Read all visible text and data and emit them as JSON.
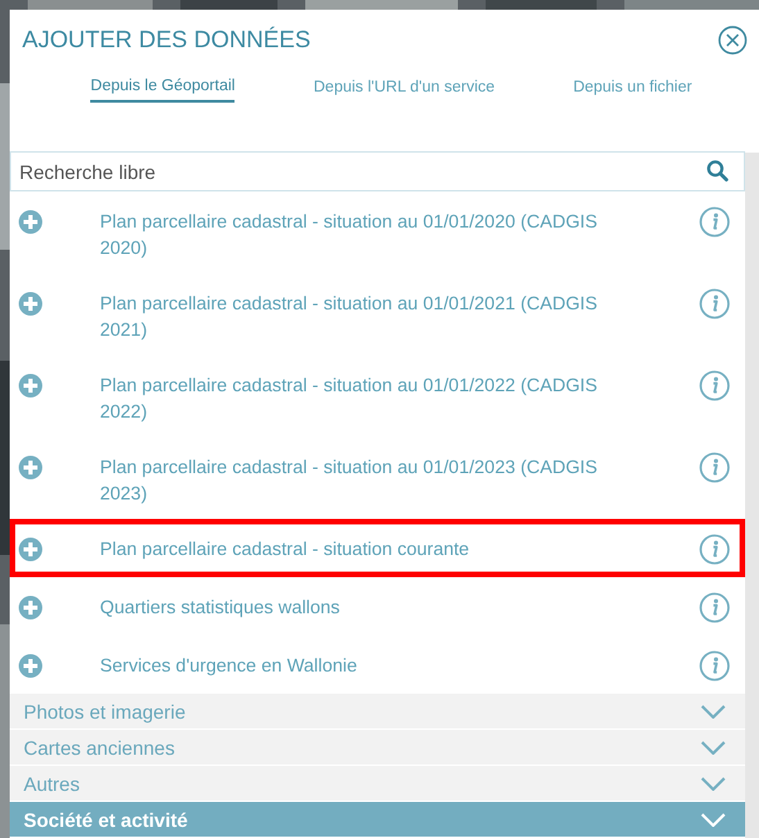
{
  "dialog": {
    "title": "AJOUTER DES DONNÉES"
  },
  "tabs": [
    {
      "label": "Depuis le Géoportail",
      "selected": true
    },
    {
      "label": "Depuis l'URL d'un service",
      "selected": false
    },
    {
      "label": "Depuis un fichier",
      "selected": false
    }
  ],
  "search": {
    "placeholder": "Recherche libre"
  },
  "layers": [
    {
      "name": "Plan parcellaire cadastral - situation au 01/01/2020 (CADGIS 2020)",
      "highlighted": false
    },
    {
      "name": "Plan parcellaire cadastral - situation au 01/01/2021 (CADGIS 2021)",
      "highlighted": false
    },
    {
      "name": "Plan parcellaire cadastral - situation au 01/01/2022 (CADGIS 2022)",
      "highlighted": false
    },
    {
      "name": "Plan parcellaire cadastral - situation au 01/01/2023 (CADGIS 2023)",
      "highlighted": false
    },
    {
      "name": "Plan parcellaire cadastral - situation courante",
      "highlighted": true
    },
    {
      "name": "Quartiers statistiques wallons",
      "highlighted": false
    },
    {
      "name": "Services d'urgence en Wallonie",
      "highlighted": false
    }
  ],
  "categories": [
    {
      "label": "Photos et imagerie",
      "active": false,
      "expanded": false
    },
    {
      "label": "Cartes anciennes",
      "active": false,
      "expanded": false
    },
    {
      "label": "Autres",
      "active": false,
      "expanded": false
    },
    {
      "label": "Société et activité",
      "active": true,
      "expanded": false
    }
  ]
}
